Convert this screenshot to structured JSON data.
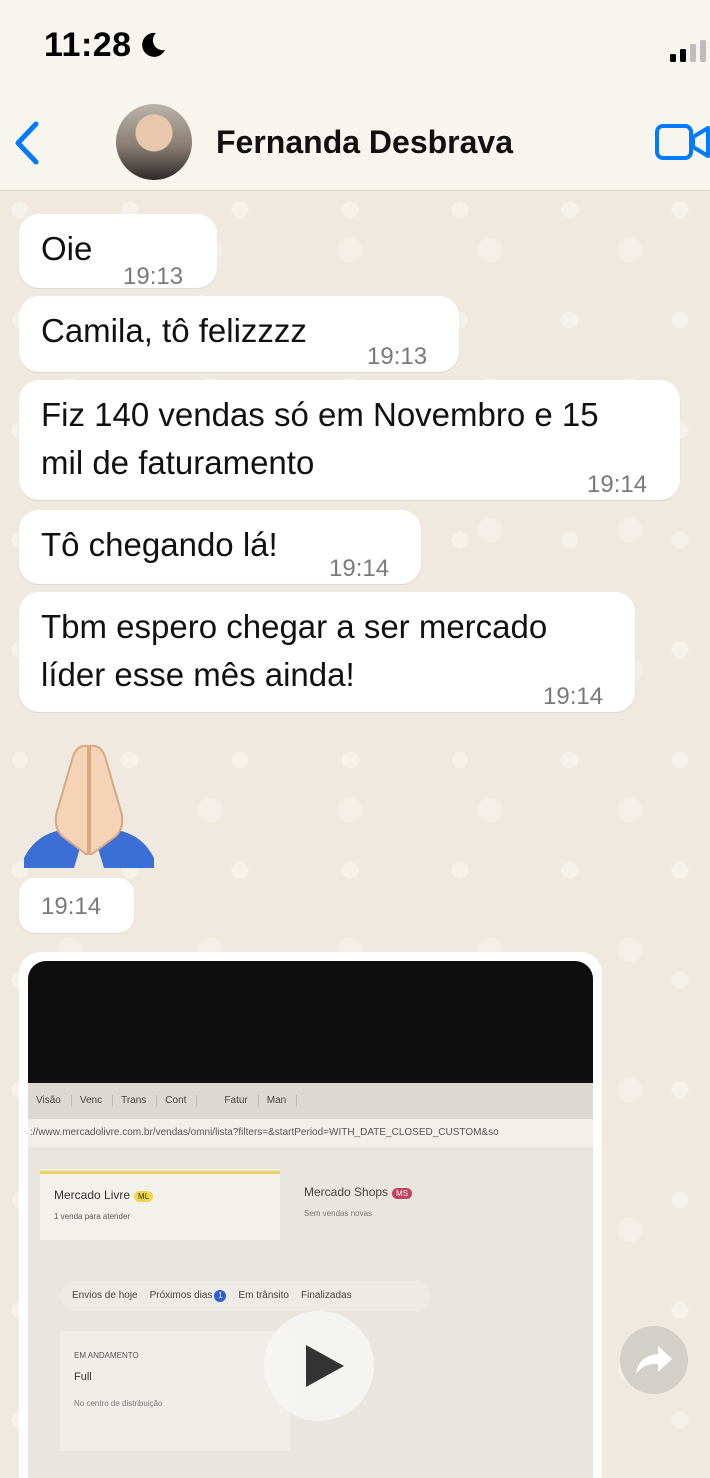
{
  "status_bar": {
    "time": "11:28"
  },
  "header": {
    "contact_name": "Fernanda Desbrava"
  },
  "messages": [
    {
      "text": "Oie",
      "time": "19:13"
    },
    {
      "text": "Camila, tô felizzzz",
      "time": "19:13"
    },
    {
      "line1": "Fiz 140 vendas só em Novembro e 15",
      "line2": "mil de faturamento",
      "time": "19:14"
    },
    {
      "text": "Tô chegando lá!",
      "time": "19:14"
    },
    {
      "line1": "Tbm espero chegar a ser mercado",
      "line2": "líder esse mês ainda!",
      "time": "19:14"
    }
  ],
  "emoji_message": {
    "emoji": "🙏",
    "time": "19:14"
  },
  "video_message": {
    "tabs": [
      "Visão",
      "Venc",
      "Trans",
      "Cont",
      "",
      "Fatur",
      "Man"
    ],
    "url": "://www.mercadolivre.com.br/vendas/omni/lista?filters=&startPeriod=WITH_DATE_CLOSED_CUSTOM&so",
    "ml_title": "Mercado Livre",
    "ml_badge": "ML",
    "ml_sub": "1 venda para atender",
    "ms_title": "Mercado Shops",
    "ms_badge": "MS",
    "ms_sub": "Sem vendas novas",
    "filters": [
      "Envios de hoje",
      "Próximos dias",
      "Em trânsito",
      "Finalizadas"
    ],
    "filter_count": "1",
    "card_status": "EM ANDAMENTO",
    "card_type": "Full",
    "card_note": "No centro de distribuição"
  },
  "colors": {
    "accent": "#007aff",
    "bubble": "#ffffff",
    "timestamp": "#7a7a7a"
  }
}
